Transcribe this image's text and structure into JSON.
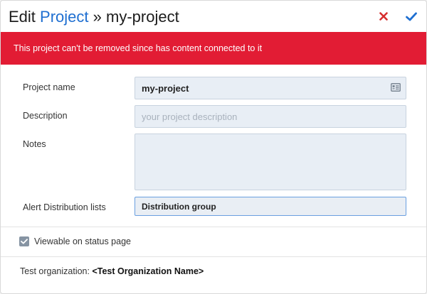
{
  "header": {
    "title_prefix": "Edit",
    "title_link": "Project",
    "title_separator": "»",
    "title_name": "my-project",
    "cancel_icon": "close-x-icon",
    "confirm_icon": "checkmark-icon",
    "cancel_color": "#d62e2e",
    "confirm_color": "#1f6fd1"
  },
  "banner": {
    "message": "This project can't be removed since has content connected to it",
    "color": "#e21c34"
  },
  "form": {
    "project_name": {
      "label": "Project name",
      "value": "my-project",
      "icon": "contact-card-icon"
    },
    "description": {
      "label": "Description",
      "value": "",
      "placeholder": "your project description"
    },
    "notes": {
      "label": "Notes",
      "value": ""
    },
    "alert_lists": {
      "label": "Alert Distribution lists",
      "value": "Distribution group"
    }
  },
  "options": {
    "viewable_label": "Viewable on status page",
    "viewable_checked": true
  },
  "footer": {
    "org_label": "Test organization:",
    "org_name": "<Test Organization Name>"
  }
}
